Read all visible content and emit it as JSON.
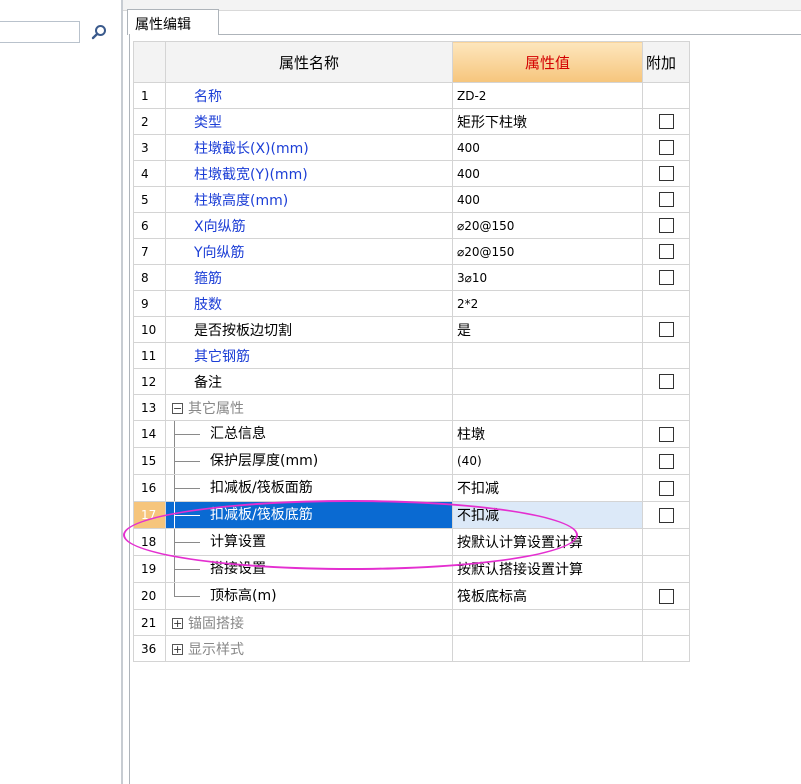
{
  "tab": {
    "label": "属性编辑"
  },
  "grid": {
    "headers": {
      "name": "属性名称",
      "value": "属性值",
      "extra": "附加"
    },
    "rows": [
      {
        "num": "1",
        "name": "名称",
        "value": "ZD-2"
      },
      {
        "num": "2",
        "name": "类型",
        "value": "矩形下柱墩"
      },
      {
        "num": "3",
        "name": "柱墩截长(X)(mm)",
        "value": "400"
      },
      {
        "num": "4",
        "name": "柱墩截宽(Y)(mm)",
        "value": "400"
      },
      {
        "num": "5",
        "name": "柱墩高度(mm)",
        "value": "400"
      },
      {
        "num": "6",
        "name": "X向纵筋",
        "value": "⌀20@150"
      },
      {
        "num": "7",
        "name": "Y向纵筋",
        "value": "⌀20@150"
      },
      {
        "num": "8",
        "name": "箍筋",
        "value": "3⌀10"
      },
      {
        "num": "9",
        "name": "肢数",
        "value": "2*2"
      },
      {
        "num": "10",
        "name": "是否按板边切割",
        "value": "是"
      },
      {
        "num": "11",
        "name": "其它钢筋",
        "value": ""
      },
      {
        "num": "12",
        "name": "备注",
        "value": ""
      },
      {
        "num": "13",
        "name": "其它属性",
        "value": "",
        "expander": "−"
      },
      {
        "num": "14",
        "name": "汇总信息",
        "value": "柱墩"
      },
      {
        "num": "15",
        "name": "保护层厚度(mm)",
        "value": "(40)"
      },
      {
        "num": "16",
        "name": "扣减板/筏板面筋",
        "value": "不扣减"
      },
      {
        "num": "17",
        "name": "扣减板/筏板底筋",
        "value": "不扣减"
      },
      {
        "num": "18",
        "name": "计算设置",
        "value": "按默认计算设置计算"
      },
      {
        "num": "19",
        "name": "搭接设置",
        "value": "按默认搭接设置计算"
      },
      {
        "num": "20",
        "name": "顶标高(m)",
        "value": "筏板底标高"
      },
      {
        "num": "21",
        "name": "锚固搭接",
        "value": "",
        "expander": "+"
      },
      {
        "num": "36",
        "name": "显示样式",
        "value": "",
        "expander": "+"
      }
    ]
  },
  "colors": {
    "name_link": "#1c3ed6",
    "header_value_text": "#d40000",
    "selection": "#0a6ad2",
    "annotation": "#e42fd0"
  },
  "icons": {
    "search": "search-icon",
    "checkbox": "checkbox-icon"
  }
}
